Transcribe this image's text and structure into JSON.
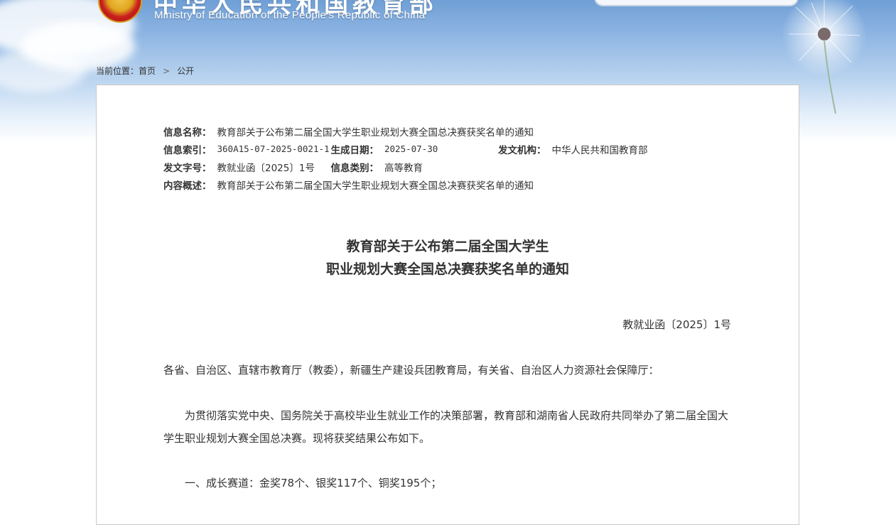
{
  "header": {
    "title_cn": "中华人民共和国教育部",
    "title_en": "Ministry of Education of the People's Republic of China"
  },
  "breadcrumb": {
    "prefix": "当前位置：",
    "home": "首页",
    "separator": ">",
    "current": "公开"
  },
  "meta": {
    "name_label": "信息名称：",
    "name_value": "教育部关于公布第二届全国大学生职业规划大赛全国总决赛获奖名单的通知",
    "index_label": "信息索引：",
    "index_value": "360A15-07-2025-0021-1",
    "date_label": "生成日期：",
    "date_value": "2025-07-30",
    "org_label": "发文机构：",
    "org_value": "中华人民共和国教育部",
    "doc_no_label": "发文字号：",
    "doc_no_value": "教就业函〔2025〕1号",
    "category_label": "信息类别：",
    "category_value": "高等教育",
    "summary_label": "内容概述：",
    "summary_value": "教育部关于公布第二届全国大学生职业规划大赛全国总决赛获奖名单的通知"
  },
  "article": {
    "title_line1": "教育部关于公布第二届全国大学生",
    "title_line2": "职业规划大赛全国总决赛获奖名单的通知",
    "doc_number": "教就业函〔2025〕1号",
    "addressee": "各省、自治区、直辖市教育厅（教委），新疆生产建设兵团教育局，有关省、自治区人力资源社会保障厅：",
    "para1": "　　为贯彻落实党中央、国务院关于高校毕业生就业工作的决策部署，教育部和湖南省人民政府共同举办了第二届全国大学生职业规划大赛全国总决赛。现将获奖结果公布如下。",
    "para2": "　　一、成长赛道：金奖78个、银奖117个、铜奖195个；"
  },
  "colors": {
    "sky_top": "#6f9fd6",
    "text": "#333333",
    "border": "#c9c9c9"
  }
}
